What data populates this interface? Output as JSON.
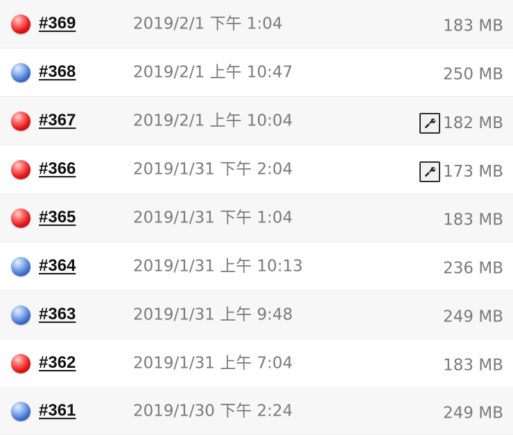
{
  "builds": [
    {
      "number": "#369",
      "status": "failed",
      "timestamp": "2019/2/1 下午 1:04",
      "size": "183 MB",
      "has_tool_icon": false
    },
    {
      "number": "#368",
      "status": "success",
      "timestamp": "2019/2/1 上午 10:47",
      "size": "250 MB",
      "has_tool_icon": false
    },
    {
      "number": "#367",
      "status": "failed",
      "timestamp": "2019/2/1 上午 10:04",
      "size": "182 MB",
      "has_tool_icon": true
    },
    {
      "number": "#366",
      "status": "failed",
      "timestamp": "2019/1/31 下午 2:04",
      "size": "173 MB",
      "has_tool_icon": true
    },
    {
      "number": "#365",
      "status": "failed",
      "timestamp": "2019/1/31 下午 1:04",
      "size": "183 MB",
      "has_tool_icon": false
    },
    {
      "number": "#364",
      "status": "success",
      "timestamp": "2019/1/31 上午 10:13",
      "size": "236 MB",
      "has_tool_icon": false
    },
    {
      "number": "#363",
      "status": "success",
      "timestamp": "2019/1/31 上午 9:48",
      "size": "249 MB",
      "has_tool_icon": false
    },
    {
      "number": "#362",
      "status": "failed",
      "timestamp": "2019/1/31 上午 7:04",
      "size": "183 MB",
      "has_tool_icon": false
    },
    {
      "number": "#361",
      "status": "success",
      "timestamp": "2019/1/30 下午 2:24",
      "size": "249 MB",
      "has_tool_icon": false
    }
  ],
  "icons": {
    "failed": "red-ball-icon",
    "success": "blue-ball-icon",
    "tool": "wrench-icon"
  },
  "colors": {
    "failed": "#e21717",
    "success": "#3f6fcc",
    "text_primary": "#111111",
    "text_secondary": "#7a7a7a"
  }
}
